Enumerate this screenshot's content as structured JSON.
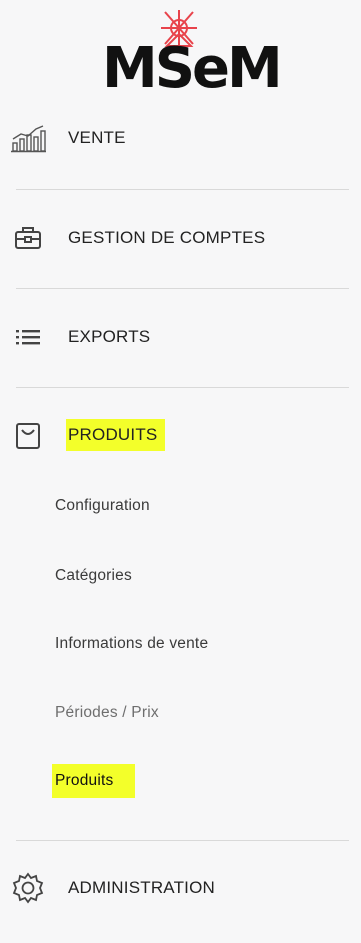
{
  "logo": {
    "text": "MSeM",
    "brand_color": "#e8434b",
    "text_color": "#111111"
  },
  "nav": {
    "vente": {
      "label": "VENTE",
      "icon": "chart-bars-icon"
    },
    "gestion": {
      "label": "GESTION DE COMPTES",
      "icon": "briefcase-icon"
    },
    "exports": {
      "label": "EXPORTS",
      "icon": "list-icon"
    },
    "produits": {
      "label": "PRODUITS",
      "icon": "shopping-bag-icon",
      "highlighted": true
    },
    "administration": {
      "label": "ADMINISTRATION",
      "icon": "gear-icon"
    }
  },
  "produits_submenu": {
    "items": [
      {
        "label": "Configuration"
      },
      {
        "label": "Catégories"
      },
      {
        "label": "Informations de vente"
      },
      {
        "label": "Périodes / Prix"
      },
      {
        "label": "Produits",
        "active": true
      }
    ]
  },
  "colors": {
    "background": "#f7f7f8",
    "highlight": "#f3ff2a",
    "divider": "#d9d9d9"
  }
}
